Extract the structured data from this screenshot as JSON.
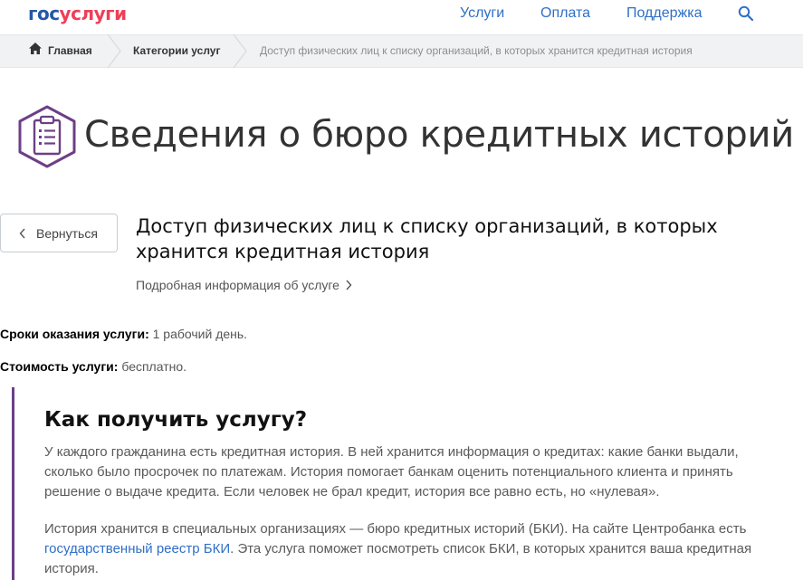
{
  "header": {
    "logo_part1": "гос",
    "logo_part2": "услуги",
    "nav": [
      "Услуги",
      "Оплата",
      "Поддержка"
    ],
    "search_icon": "search-icon"
  },
  "breadcrumbs": {
    "home": "Главная",
    "category": "Категории услуг",
    "current": "Доступ физических лиц к списку организаций, в которых хранится кредитная история"
  },
  "page": {
    "title": "Сведения о бюро кредитных историй",
    "title_icon": "clipboard-list-icon"
  },
  "back_button": "Вернуться",
  "service": {
    "title": "Доступ физических лиц к списку организаций, в которых хранится кредитная история",
    "detail_link": "Подробная информация об услуге"
  },
  "info": {
    "term_label": "Сроки оказания услуги:",
    "term_value": " 1 рабочий день.",
    "cost_label": "Стоимость услуги:",
    "cost_value": " бесплатно."
  },
  "howto": {
    "title": "Как получить услугу?",
    "p1": "У каждого гражданина есть кредитная история. В ней хранится информация о кредитах: какие банки выдали, сколько было просрочек по платежам. История помогает банкам оценить потенциального клиента и принять решение о выдаче кредита. Если человек не брал кредит, история все равно есть, но «нулевая».",
    "p2_before": "История хранится в специальных организациях — бюро кредитных историй (БКИ). На сайте Центробанка есть ",
    "p2_link": "государственный реестр БКИ",
    "p2_after": ". Эта услуга поможет посмотреть список БКИ, в которых хранится ваша кредитная история."
  },
  "colors": {
    "accent_purple": "#6d3f87",
    "link_blue": "#2e6fc7",
    "logo_blue": "#2457a7",
    "logo_red": "#ee3f58"
  }
}
